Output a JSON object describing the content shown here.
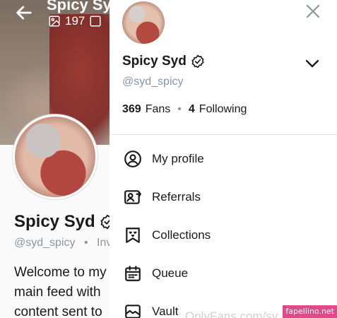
{
  "background": {
    "cover_name": "Spicy Sy",
    "cover_media_count": "197",
    "name": "Spicy Syd",
    "handle": "@syd_spicy",
    "handle_suffix": "Inv",
    "bio_lines": [
      "Welcome to my",
      "main feed with",
      "content sent to"
    ]
  },
  "drawer": {
    "name": "Spicy Syd",
    "handle": "@syd_spicy",
    "fans_count": "369",
    "fans_label": "Fans",
    "following_count": "4",
    "following_label": "Following",
    "menu": [
      {
        "label": "My profile",
        "icon": "user-circle-icon"
      },
      {
        "label": "Referrals",
        "icon": "referrals-icon"
      },
      {
        "label": "Collections",
        "icon": "collections-icon"
      },
      {
        "label": "Queue",
        "icon": "calendar-icon"
      },
      {
        "label": "Vault",
        "icon": "vault-icon"
      }
    ]
  },
  "watermark": {
    "faint_text": "OnlyFans.com/sy",
    "badge_text": "fapellino.net"
  },
  "colors": {
    "text": "#1a1a1a",
    "muted": "#8a96a3",
    "badge": "#e04a8a"
  }
}
